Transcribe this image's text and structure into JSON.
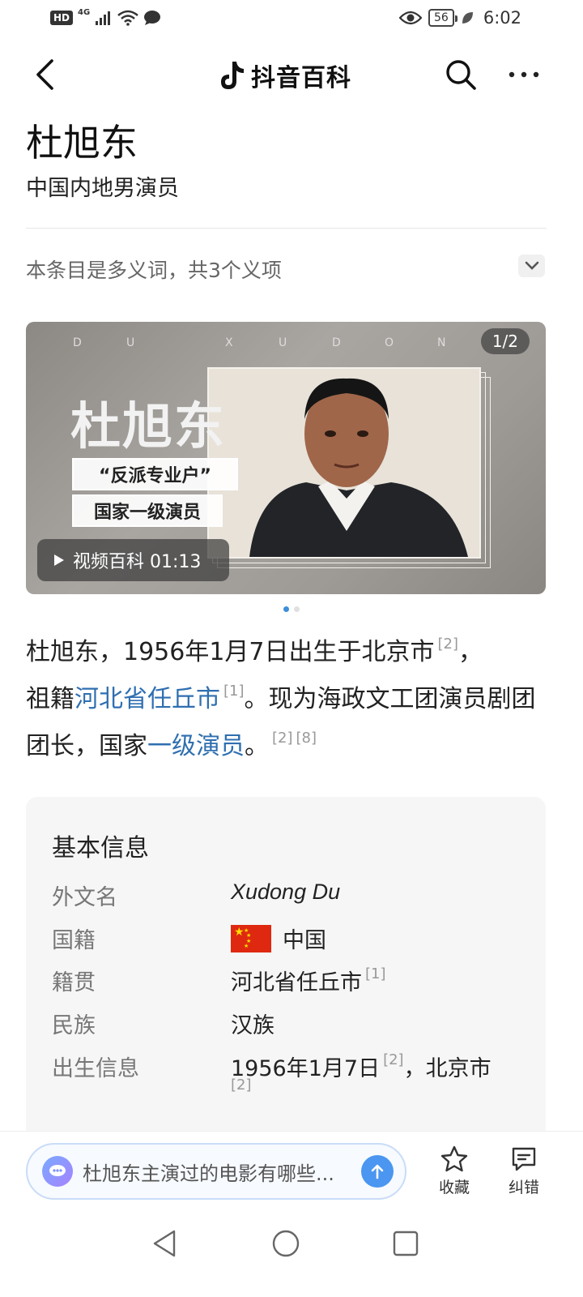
{
  "status_bar": {
    "network": "HD",
    "signal_type": "4G",
    "battery": "56",
    "time": "6:02",
    "icons": [
      "hd-icon",
      "signal-icon",
      "wifi-icon",
      "message-icon",
      "eye-icon",
      "battery-icon",
      "leaf-icon"
    ]
  },
  "nav": {
    "brand": "抖音百科",
    "icons": [
      "back-icon",
      "douyin-logo-icon",
      "search-icon",
      "more-icon"
    ]
  },
  "entry": {
    "title": "杜旭东",
    "subtitle": "中国内地男演员",
    "polysemy_note": "本条目是多义词，共3个义项"
  },
  "hero": {
    "letters": [
      "D",
      "U",
      "X",
      "U",
      "D",
      "O",
      "N"
    ],
    "counter": "1/2",
    "big_name": "杜旭东",
    "tag1": "“反派专业户”",
    "tag2": "国家一级演员",
    "video_label": "视频百科 01:13"
  },
  "intro": {
    "p1": "杜旭东，1956年1月7日出生于北京市",
    "ref1": "[2]",
    "p1_end": "，",
    "p2": "祖籍",
    "link1": "河北省任丘市",
    "ref2": "[1]",
    "p3": "。现为海政文工团演员剧团团长，国家",
    "link2": "一级演员",
    "p4": "。",
    "ref3": "[2]",
    "ref4": "[8]"
  },
  "infobox": {
    "title": "基本信息",
    "rows": [
      {
        "key": "外文名",
        "value": "Xudong Du"
      },
      {
        "key": "国籍",
        "value": "中国"
      },
      {
        "key": "籍贯",
        "value": "河北省任丘市",
        "ref": "[1]"
      },
      {
        "key": "民族",
        "value": "汉族"
      },
      {
        "key": "出生信息",
        "value": "1956年1月7日",
        "ref": "[2]",
        "value2": "，北京市",
        "ref2": "[2]"
      }
    ]
  },
  "bottom": {
    "ask_placeholder": "杜旭东主演过的电影有哪些...",
    "collect_label": "收藏",
    "correct_label": "纠错"
  },
  "colors": {
    "link": "#2f6fb0",
    "accent_blue": "#4a96f0",
    "flag_red": "#de2910"
  }
}
